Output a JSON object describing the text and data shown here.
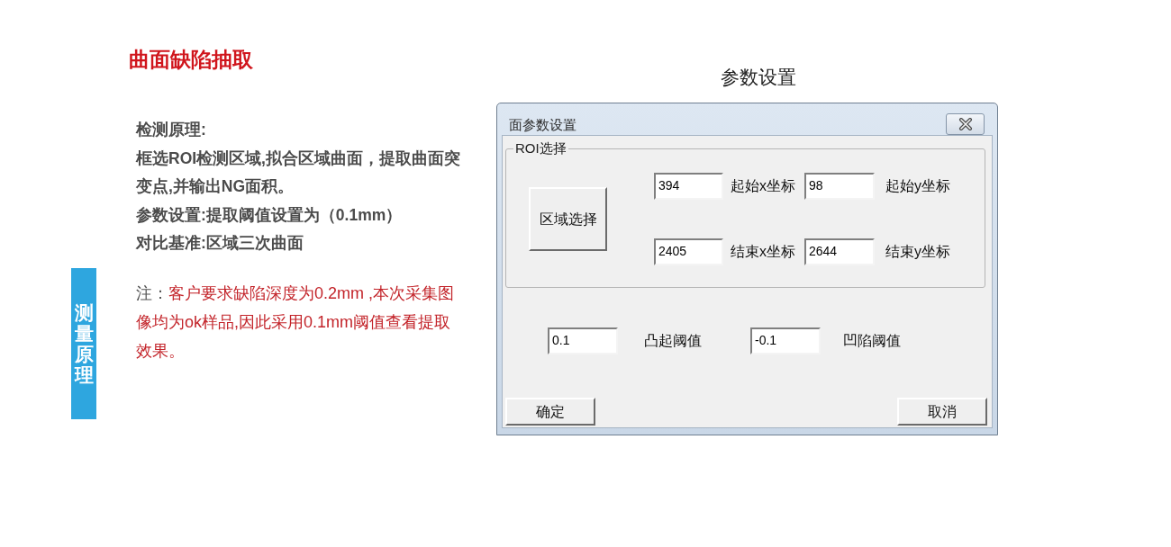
{
  "section_tab": "测量原理",
  "heading": "曲面缺陷抽取",
  "principle": {
    "heading": "检测原理:",
    "lines": [
      "框选ROI检测区域,拟合区域曲面，提取曲面突变点,并输出NG面积。",
      "参数设置:提取阈值设置为（0.1mm）",
      "对比基准:区域三次曲面"
    ]
  },
  "note": {
    "label": "注：",
    "text": "客户要求缺陷深度为0.2mm ,本次采集图像均为ok样品,因此采用0.1mm阈值查看提取效果。"
  },
  "caption": "参数设置",
  "dialog": {
    "title": "面参数设置",
    "group": {
      "legend": "ROI选择",
      "button": "区域选择",
      "rows": [
        [
          {
            "kind": "field",
            "value": "394"
          },
          {
            "kind": "label",
            "text": "起始x坐标"
          },
          {
            "kind": "field",
            "value": "98"
          },
          {
            "kind": "label",
            "text": "起始y坐标"
          }
        ],
        [
          {
            "kind": "field",
            "value": "2405"
          },
          {
            "kind": "label",
            "text": "结束x坐标"
          },
          {
            "kind": "field",
            "value": "2644"
          },
          {
            "kind": "label",
            "text": "结束y坐标"
          }
        ]
      ]
    },
    "thresholds": [
      {
        "kind": "field",
        "value": "0.1"
      },
      {
        "kind": "label",
        "text": "凸起阈值"
      },
      {
        "kind": "field",
        "value": "-0.1"
      },
      {
        "kind": "label",
        "text": "凹陷阈值"
      }
    ],
    "buttons": [
      {
        "label": "确定"
      },
      {
        "label": "取消"
      }
    ]
  }
}
